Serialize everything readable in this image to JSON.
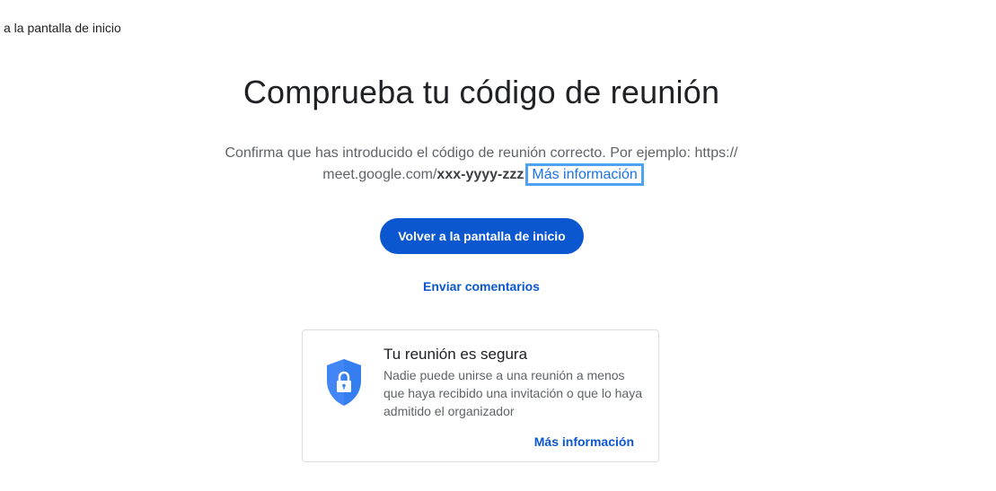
{
  "skip_link": "a la pantalla de inicio",
  "title": "Comprueba tu código de reunión",
  "description": {
    "line1": "Confirma que has introducido el código de reunión correcto. Por ejemplo: https://",
    "line2_prefix": "meet.google.com/",
    "code_example": "xxx-yyyy-zzz",
    "more_info_link": "Más información"
  },
  "primary_button": "Volver a la pantalla de inicio",
  "feedback_link": "Enviar comentarios",
  "security_card": {
    "title": "Tu reunión es segura",
    "text": "Nadie puede unirse a una reunión a menos que haya recibido una invitación o que lo haya admitido el organizador",
    "more_info_link": "Más información",
    "icon": "shield-lock-icon"
  },
  "colors": {
    "primary": "#0b57d0",
    "link": "#1a73e8",
    "focus_outline": "#4ea1f3",
    "shield": "#4285f4"
  }
}
